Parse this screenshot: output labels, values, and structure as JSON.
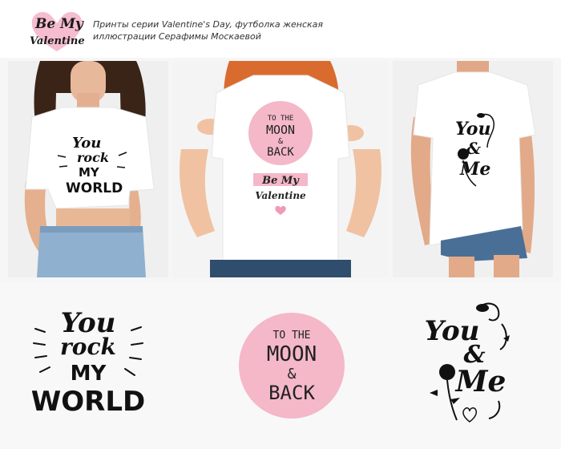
{
  "header": {
    "logo": {
      "line1": "Be My",
      "line2": "Valentine",
      "heart_color": "#f6bcd0"
    },
    "caption_line1": "Принты серии Valentine's Day, футболка женская",
    "caption_line2": "иллюстрации Серафимы Москаевой"
  },
  "photos": [
    {
      "shirt": {
        "line1": "You",
        "line2": "rock",
        "line3": "MY",
        "line4": "WORLD"
      }
    },
    {
      "shirt": {
        "circle": {
          "line1": "TO THE",
          "line2": "MOON",
          "line3": "&",
          "line4": "BACK"
        },
        "banner": {
          "line1": "Be My",
          "line2": "Valentine"
        }
      }
    },
    {
      "shirt": {
        "line1": "You",
        "line2": "&",
        "line3": "Me"
      }
    }
  ],
  "designs": {
    "rock": {
      "line1": "You",
      "line2": "rock",
      "line3": "MY",
      "line4": "WORLD"
    },
    "moon": {
      "line1": "TO THE",
      "line2": "MOON",
      "line3": "&",
      "line4": "BACK",
      "circle_color": "#f4b8c8"
    },
    "you_me": {
      "line1": "You",
      "line2": "&",
      "line3": "Me"
    }
  }
}
